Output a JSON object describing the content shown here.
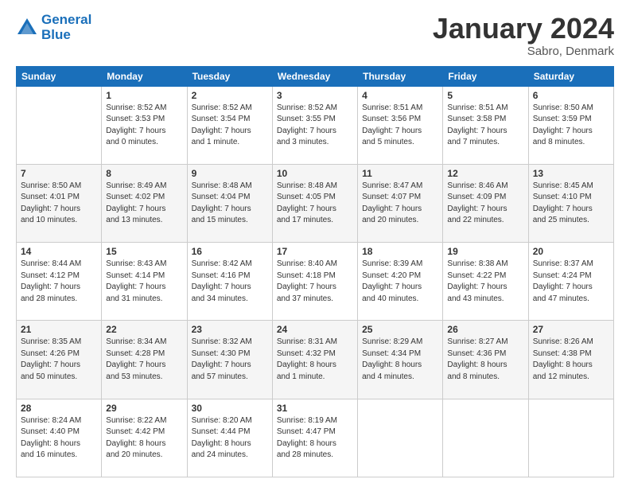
{
  "logo": {
    "line1": "General",
    "line2": "Blue"
  },
  "header": {
    "month": "January 2024",
    "location": "Sabro, Denmark"
  },
  "weekdays": [
    "Sunday",
    "Monday",
    "Tuesday",
    "Wednesday",
    "Thursday",
    "Friday",
    "Saturday"
  ],
  "weeks": [
    [
      {
        "day": "",
        "info": ""
      },
      {
        "day": "1",
        "info": "Sunrise: 8:52 AM\nSunset: 3:53 PM\nDaylight: 7 hours\nand 0 minutes."
      },
      {
        "day": "2",
        "info": "Sunrise: 8:52 AM\nSunset: 3:54 PM\nDaylight: 7 hours\nand 1 minute."
      },
      {
        "day": "3",
        "info": "Sunrise: 8:52 AM\nSunset: 3:55 PM\nDaylight: 7 hours\nand 3 minutes."
      },
      {
        "day": "4",
        "info": "Sunrise: 8:51 AM\nSunset: 3:56 PM\nDaylight: 7 hours\nand 5 minutes."
      },
      {
        "day": "5",
        "info": "Sunrise: 8:51 AM\nSunset: 3:58 PM\nDaylight: 7 hours\nand 7 minutes."
      },
      {
        "day": "6",
        "info": "Sunrise: 8:50 AM\nSunset: 3:59 PM\nDaylight: 7 hours\nand 8 minutes."
      }
    ],
    [
      {
        "day": "7",
        "info": "Sunrise: 8:50 AM\nSunset: 4:01 PM\nDaylight: 7 hours\nand 10 minutes."
      },
      {
        "day": "8",
        "info": "Sunrise: 8:49 AM\nSunset: 4:02 PM\nDaylight: 7 hours\nand 13 minutes."
      },
      {
        "day": "9",
        "info": "Sunrise: 8:48 AM\nSunset: 4:04 PM\nDaylight: 7 hours\nand 15 minutes."
      },
      {
        "day": "10",
        "info": "Sunrise: 8:48 AM\nSunset: 4:05 PM\nDaylight: 7 hours\nand 17 minutes."
      },
      {
        "day": "11",
        "info": "Sunrise: 8:47 AM\nSunset: 4:07 PM\nDaylight: 7 hours\nand 20 minutes."
      },
      {
        "day": "12",
        "info": "Sunrise: 8:46 AM\nSunset: 4:09 PM\nDaylight: 7 hours\nand 22 minutes."
      },
      {
        "day": "13",
        "info": "Sunrise: 8:45 AM\nSunset: 4:10 PM\nDaylight: 7 hours\nand 25 minutes."
      }
    ],
    [
      {
        "day": "14",
        "info": "Sunrise: 8:44 AM\nSunset: 4:12 PM\nDaylight: 7 hours\nand 28 minutes."
      },
      {
        "day": "15",
        "info": "Sunrise: 8:43 AM\nSunset: 4:14 PM\nDaylight: 7 hours\nand 31 minutes."
      },
      {
        "day": "16",
        "info": "Sunrise: 8:42 AM\nSunset: 4:16 PM\nDaylight: 7 hours\nand 34 minutes."
      },
      {
        "day": "17",
        "info": "Sunrise: 8:40 AM\nSunset: 4:18 PM\nDaylight: 7 hours\nand 37 minutes."
      },
      {
        "day": "18",
        "info": "Sunrise: 8:39 AM\nSunset: 4:20 PM\nDaylight: 7 hours\nand 40 minutes."
      },
      {
        "day": "19",
        "info": "Sunrise: 8:38 AM\nSunset: 4:22 PM\nDaylight: 7 hours\nand 43 minutes."
      },
      {
        "day": "20",
        "info": "Sunrise: 8:37 AM\nSunset: 4:24 PM\nDaylight: 7 hours\nand 47 minutes."
      }
    ],
    [
      {
        "day": "21",
        "info": "Sunrise: 8:35 AM\nSunset: 4:26 PM\nDaylight: 7 hours\nand 50 minutes."
      },
      {
        "day": "22",
        "info": "Sunrise: 8:34 AM\nSunset: 4:28 PM\nDaylight: 7 hours\nand 53 minutes."
      },
      {
        "day": "23",
        "info": "Sunrise: 8:32 AM\nSunset: 4:30 PM\nDaylight: 7 hours\nand 57 minutes."
      },
      {
        "day": "24",
        "info": "Sunrise: 8:31 AM\nSunset: 4:32 PM\nDaylight: 8 hours\nand 1 minute."
      },
      {
        "day": "25",
        "info": "Sunrise: 8:29 AM\nSunset: 4:34 PM\nDaylight: 8 hours\nand 4 minutes."
      },
      {
        "day": "26",
        "info": "Sunrise: 8:27 AM\nSunset: 4:36 PM\nDaylight: 8 hours\nand 8 minutes."
      },
      {
        "day": "27",
        "info": "Sunrise: 8:26 AM\nSunset: 4:38 PM\nDaylight: 8 hours\nand 12 minutes."
      }
    ],
    [
      {
        "day": "28",
        "info": "Sunrise: 8:24 AM\nSunset: 4:40 PM\nDaylight: 8 hours\nand 16 minutes."
      },
      {
        "day": "29",
        "info": "Sunrise: 8:22 AM\nSunset: 4:42 PM\nDaylight: 8 hours\nand 20 minutes."
      },
      {
        "day": "30",
        "info": "Sunrise: 8:20 AM\nSunset: 4:44 PM\nDaylight: 8 hours\nand 24 minutes."
      },
      {
        "day": "31",
        "info": "Sunrise: 8:19 AM\nSunset: 4:47 PM\nDaylight: 8 hours\nand 28 minutes."
      },
      {
        "day": "",
        "info": ""
      },
      {
        "day": "",
        "info": ""
      },
      {
        "day": "",
        "info": ""
      }
    ]
  ]
}
